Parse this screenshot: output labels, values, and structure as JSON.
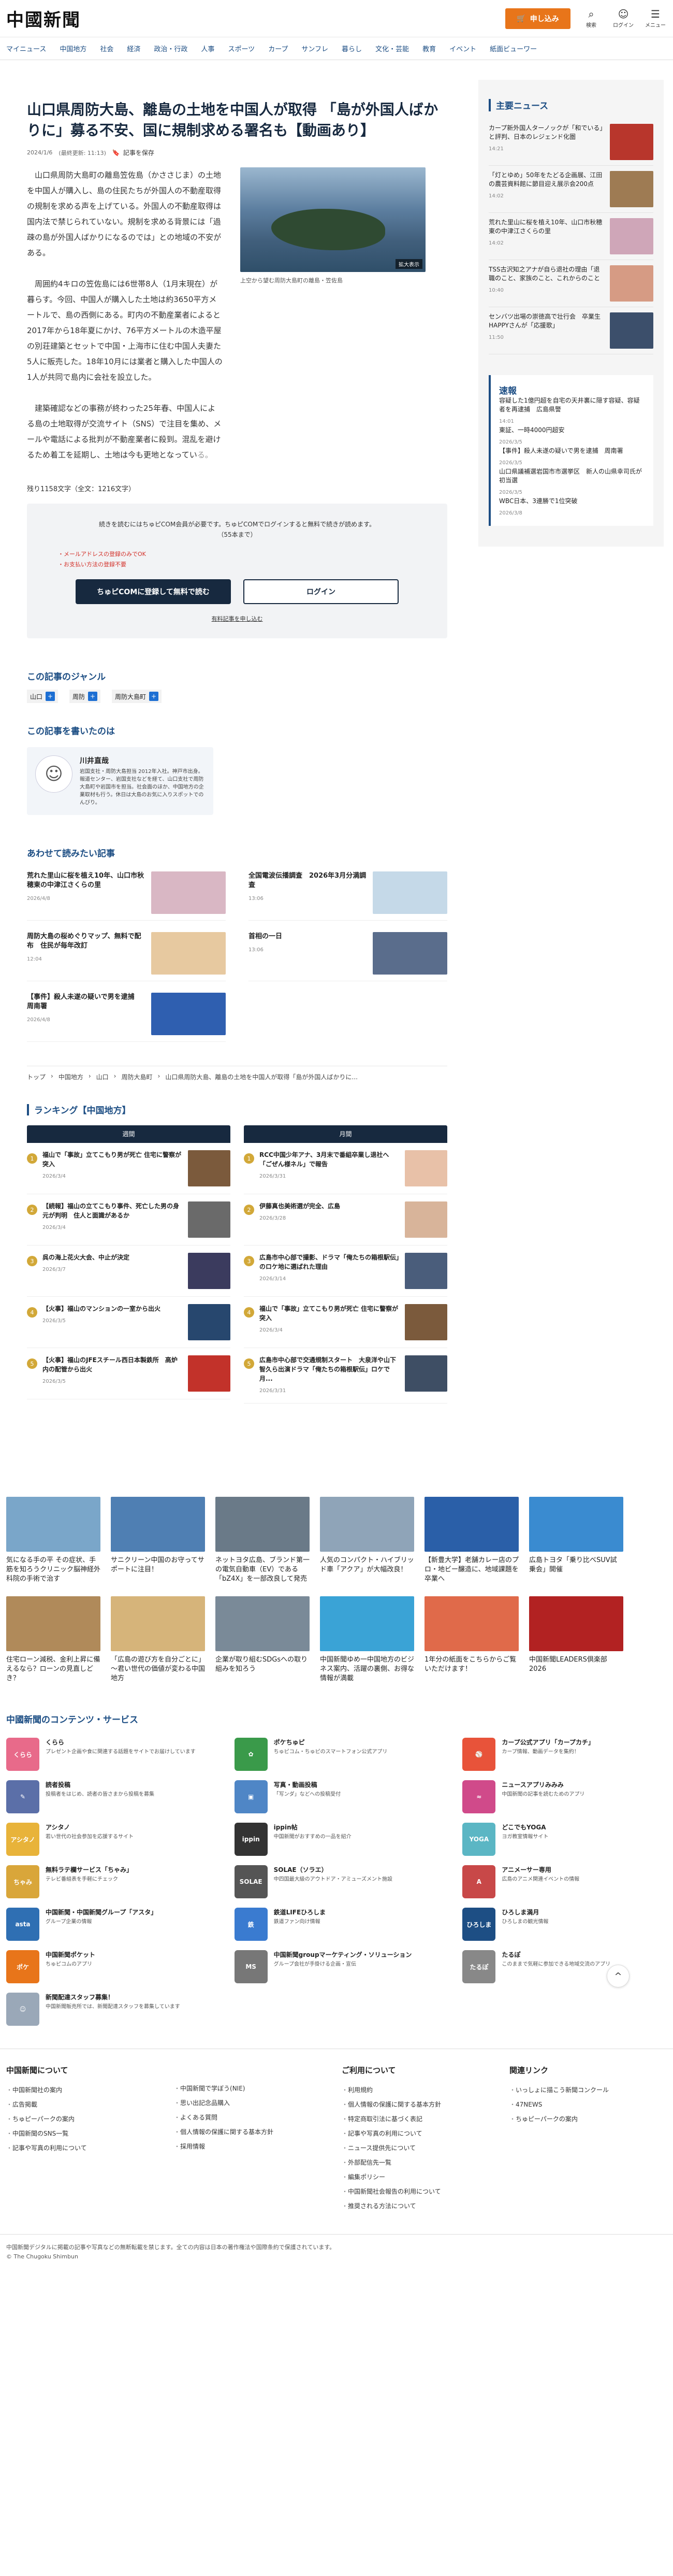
{
  "header": {
    "logo": "中國新聞",
    "subscribe_label": "申し込み",
    "search_label": "検索",
    "login_label": "ログイン",
    "menu_label": "メニュー"
  },
  "nav": [
    "マイニュース",
    "中国地方",
    "社会",
    "経済",
    "政治・行政",
    "人事",
    "スポーツ",
    "カープ",
    "サンフレ",
    "暮らし",
    "文化・芸能",
    "教育",
    "イベント",
    "紙面ビューワー"
  ],
  "article": {
    "title": "山口県周防大島、離島の土地を中国人が取得 「島が外国人ばかりに」募る不安、国に規制求める署名も【動画あり】",
    "date": "2024/1/6",
    "updated": "(最終更新: 11:13)",
    "bookmark_label": "記事を保存",
    "paragraphs": [
      "山口県周防大島町の離島笠佐島（かささじま）の土地を中国人が購入し、島の住民たちが外国人の不動産取得の規制を求める声を上げている。外国人の不動産取得は国内法で禁じられていない。規制を求める背景には「過疎の島が外国人ばかりになるのでは」との地域の不安がある。",
      "周囲約4キロの笠佐島には6世帯8人（1月末現在）が暮らす。今回、中国人が購入した土地は約3650平方メートルで、島の西側にある。町内の不動産業者によると2017年から18年夏にかけ、76平方メートルの木造平屋の別荘建築とセットで中国・上海市に住む中国人夫妻た5人に販売した。18年10月には業者と購入した中国人の1人が共同で島内に会社を設立した。",
      "建築確認などの事務が終わった25年春、中国人による島の土地取得が交流サイト（SNS）で注目を集め、メールや電話による批判が不動産業者に殺到。混乱を避けるため着工を延期し、土地は今も更地となってい"
    ],
    "fade_tail": "る。",
    "figure_caption": "上空から望む周防大島町の離島・笠佐島",
    "enlarge_label": "拡大表示",
    "char_count": "残り1158文字（全文：1216文字）"
  },
  "paywall": {
    "message_1": "続きを読むにはちゅピCOM会員が必要です。ちゅピCOMでログインすると無料で続きが読めます。",
    "message_2": "（55本まで）",
    "list": [
      "・メールアドレスの登録のみでOK",
      "・お支払い方法の登録不要"
    ],
    "register_label": "ちゅピCOMに登録して無料で読む",
    "login_label": "ログイン",
    "terms_label": "有料記事を申し込む"
  },
  "genre": {
    "heading": "この記事のジャンル",
    "tags": [
      "山口",
      "周防",
      "周防大島町"
    ]
  },
  "writer": {
    "heading": "この記事を書いたのは",
    "name": "川井直哉",
    "bio": "岩国支社・周防大島担当 2012年入社。神戸市出身。報道センター、岩国支社などを経て、山口支社で周防大島町や岩国市を担当。社会面のほか、中国地方の企業取材も行う。休日は大島のお気に入りスポットでのんびり。"
  },
  "related": {
    "heading": "あわせて読みたい記事",
    "items": [
      {
        "title": "荒れた里山に桜を植え10年、山口市秋穂東の中津江さくらの里",
        "date": "2026/4/8",
        "color": "#d9b7c4"
      },
      {
        "title": "全国電波伝播調査　2026年3月分満調査",
        "date": "13:06",
        "color": "#c5d9e8"
      },
      {
        "title": "周防大島の桜めぐりマップ、無料で配布　住民が毎年改訂",
        "date": "12:04",
        "color": "#e7c9a0"
      },
      {
        "title": "首相の一日",
        "date": "13:06",
        "color": "#5a6d8c"
      },
      {
        "title": "【事件】殺人未遂の疑いで男を逮捕　周南署",
        "date": "2026/4/8",
        "color": "#2f5fb0"
      }
    ]
  },
  "breadcrumb": [
    "トップ",
    "中国地方",
    "山口",
    "周防大島町",
    "山口県周防大島、離島の土地を中国人が取得「島が外国人ばかりに..."
  ],
  "ranking": {
    "heading": "ランキング【中国地方】",
    "weekly_label": "週間",
    "monthly_label": "月間",
    "weekly": [
      {
        "title": "福山で「事故」立てこもり男が死亡 住宅に警察が突入",
        "date": "2026/3/4",
        "color": "#7b5a3c"
      },
      {
        "title": "【続報】福山の立てこもり事件、死亡した男の身元が判明　住人と面識があるか",
        "date": "2026/3/4",
        "color": "#6a6a6a"
      },
      {
        "title": "呉の海上花火大会、中止が決定",
        "date": "2026/3/7",
        "color": "#3b3b5e"
      },
      {
        "title": "【火事】福山のマンションの一室から出火",
        "date": "2026/3/5",
        "color": "#27476e"
      },
      {
        "title": "【火事】福山のJFEスチール西日本製鉄所　高炉内の配管から出火",
        "date": "2026/3/5",
        "color": "#c2322a"
      }
    ],
    "monthly": [
      {
        "title": "RCC中国少年アナ、3月末で番組卒業し退社へ「ごぜん様ネル」で報告",
        "date": "2026/3/31",
        "color": "#e8c1a8"
      },
      {
        "title": "伊藤真也美術選が完全、広島",
        "date": "2026/3/28",
        "color": "#d8b49a"
      },
      {
        "title": "広島市中心部で撮影、ドラマ「俺たちの箱根駅伝」のロケ地に選ばれた理由",
        "date": "2026/3/14",
        "color": "#4a5d7b"
      },
      {
        "title": "福山で「事故」立てこもり男が死亡 住宅に警察が突入",
        "date": "2026/3/4",
        "color": "#7b5a3c"
      },
      {
        "title": "広島市中心部で交通規制スタート　大泉洋や山下智久ら出演ドラマ「俺たちの箱根駅伝」ロケで月...",
        "date": "2026/3/31",
        "color": "#3e4e64"
      }
    ]
  },
  "side": {
    "main_news_heading": "主要ニュース",
    "main_news": [
      {
        "title": "カープ新外国人ターノックが「和でいる」と評判、日本のレジェンド化圏",
        "date": "14:21",
        "color": "#b8362c"
      },
      {
        "title": "「灯とゆめ」50年をたどる企画展、江田の農芸資料館に節目迎え展示会200点",
        "date": "14:02",
        "color": "#9e7b53"
      },
      {
        "title": "荒れた里山に桜を植え10年、山口市秋穂東の中津江さくらの里",
        "date": "14:02",
        "color": "#cfa6b8"
      },
      {
        "title": "TSS古沢知之アナが自ら退社の理由「退職のこと、家族のこと、これからのこと",
        "date": "10:40",
        "color": "#d69b84"
      },
      {
        "title": "センバツ出場の崇徳高で壮行会　卒業生HAPPYさんが「応援歌」",
        "date": "11:50",
        "color": "#3c4f6b"
      }
    ],
    "sokuho_heading": "速報",
    "sokuho": [
      {
        "title": "容疑した1億円超を自宅の天井裏に隠す容疑、容疑者を再逮捕　広島県警",
        "date": "14:01"
      },
      {
        "title": "東証、一時4000円超安",
        "date": "2026/3/5"
      },
      {
        "title": "【事件】殺人未遂の疑いで男を逮捕　周南署",
        "date": "2026/3/5"
      },
      {
        "title": "山口県議補選岩国市市選挙区　新人の山県幸司氏が初当選",
        "date": "2026/3/5"
      },
      {
        "title": "WBC日本、3連勝で1位突破",
        "date": "2026/3/8"
      }
    ]
  },
  "features": [
    {
      "title": "気になる手の平 その症状、手筋を知ろうクリニック脳神経外科院の手術で治す",
      "color": "#7aa6c9"
    },
    {
      "title": "サニクリーン中国のお守ってサポートに注目！",
      "color": "#4f7fb3"
    },
    {
      "title": "ネットヨタ広島、ブランド第一の電気自動車（EV）である「bZ4X」を一部改良して発売",
      "color": "#6a7a88"
    },
    {
      "title": "人気のコンパクト・ハイブリッド車「アクア」が大幅改良！",
      "color": "#8fa4b8"
    },
    {
      "title": "【新豊大学】老舗カレー店のプロ・地ビー醸造に、地域課題を卒業へ",
      "color": "#2a5fa8"
    },
    {
      "title": "広島トヨタ「乗り比べSUV試乗会」開催",
      "color": "#3a8bd0"
    },
    {
      "title": "住宅ローン減税、金利上昇に備えるなら？ローンの見直しどき？",
      "color": "#b08a5a"
    },
    {
      "title": "「広島の遊び方を自分ごとに」～君い世代の価値が変わる中国地方",
      "color": "#d6b47a"
    },
    {
      "title": "企業が取り組むSDGsへの取り組みを知ろう",
      "color": "#7a8a98"
    },
    {
      "title": "中国新聞ゆめ一中国地方のビジネス案内、活躍の裏側、お得な情報が満載",
      "color": "#3aa3d6"
    },
    {
      "title": "1年分の紙面をこちらからご覧いただけます！",
      "color": "#e06a4a"
    },
    {
      "title": "中国新聞LEADERS倶楽部2026",
      "color": "#b22222"
    }
  ],
  "services_heading": "中國新聞のコンテンツ・サービス",
  "services": [
    {
      "title": "くらら",
      "desc": "プレゼント企画や食に関連する話題をサイトでお届けしています",
      "color": "#e86a8a",
      "icon": "くらら"
    },
    {
      "title": "ポケちゅピ",
      "desc": "ちゅピコム・ちゅピのスマートフォン公式アプリ",
      "color": "#3a9a4a",
      "icon": "✿"
    },
    {
      "title": "カープ公式アプリ「カープカチ」",
      "desc": "カープ情報、動画データを集約！",
      "color": "#e8533a",
      "icon": "⚾"
    },
    {
      "title": "読者投稿",
      "desc": "投稿者をはじめ、読者の皆さまから投稿を募集",
      "color": "#5b6fa8",
      "icon": "✎"
    },
    {
      "title": "写真・動画投稿",
      "desc": "「写ンダ」などへの投稿受付",
      "color": "#4f86c6",
      "icon": "▣"
    },
    {
      "title": "ニュースアプリみみみ",
      "desc": "中国新聞の記事を読むためのアプリ",
      "color": "#d04a8a",
      "icon": "≈"
    },
    {
      "title": "アシタノ",
      "desc": "若い世代の社会参加を応援するサイト",
      "color": "#e8b33a",
      "icon": "アシタノ"
    },
    {
      "title": "ippin帖",
      "desc": "中国新聞がおすすめの一品を紹介",
      "color": "#333333",
      "icon": "ippin"
    },
    {
      "title": "どこでもYOGA",
      "desc": "ヨガ教室情報サイト",
      "color": "#5bb6c4",
      "icon": "YOGA"
    },
    {
      "title": "無料ラテ欄サービス「ちゃみ」",
      "desc": "テレビ番組表を手軽にチェック",
      "color": "#d9a63a",
      "icon": "ちゃみ"
    },
    {
      "title": "SOLAE（ソラエ）",
      "desc": "中四国最大級のアウトドア・アミューズメント施設",
      "color": "#555555",
      "icon": "SOLAE"
    },
    {
      "title": "アニメーサー専用",
      "desc": "広島のアニメ関連イベントの情報",
      "color": "#c84848",
      "icon": "A"
    },
    {
      "title": "中国新聞・中国新聞グループ「アスタ」",
      "desc": "グループ企業の情報",
      "color": "#2f6fb3",
      "icon": "asta"
    },
    {
      "title": "鉄道LIFEひろしま",
      "desc": "鉄道ファン向け情報",
      "color": "#3a7bd0",
      "icon": "鉄"
    },
    {
      "title": "ひろしま満月",
      "desc": "ひろしまの観光情報",
      "color": "#1d4e84",
      "icon": "ひろしま"
    },
    {
      "title": "中国新聞ポケット",
      "desc": "ちゅピコムのアプリ",
      "color": "#e8751a",
      "icon": "ポケ"
    },
    {
      "title": "中国新聞groupマーケティング・ソリューション",
      "desc": "グループ会社が手掛ける企画・宣伝",
      "color": "#777777",
      "icon": "MS"
    },
    {
      "title": "たるぽ",
      "desc": "このままで気軽に参加できる地域交流のアプリ",
      "color": "#888888",
      "icon": "たるぽ"
    },
    {
      "title": "新聞配達スタッフ募集！",
      "desc": "中国新聞販売所では、新聞配達スタッフを募集しています",
      "color": "#9aa8b8",
      "icon": "☺"
    }
  ],
  "footer": {
    "col1_heading": "中国新聞について",
    "col1": [
      "中国新聞社の案内",
      "広告掲載",
      "ちゅピーパークの案内",
      "中国新聞のSNS一覧",
      "記事や写真の利用について"
    ],
    "col2": [
      "中国新聞で学ぼう(NIE)",
      "思い出記念品購入",
      "よくある質問",
      "個人情報の保護に関する基本方針",
      "採用情報"
    ],
    "col3_heading": "ご利用について",
    "col3": [
      "利用規約",
      "個人情報の保護に関する基本方針",
      "特定商取引法に基づく表記",
      "記事や写真の利用について",
      "ニュース提供先について",
      "外部配信先一覧",
      "編集ポリシー",
      "中国新聞社会報告の利用について",
      "推奨される方法について"
    ],
    "col4_heading": "関連リンク",
    "col4": [
      "いっしょに描こう新聞コンクール",
      "47NEWS",
      "ちゅピーパークの案内"
    ]
  },
  "copyright": {
    "line1": "中国新聞デジタルに掲載の記事や写真などの無断転載を禁じます。全ての内容は日本の著作権法や国際条約で保護されています。",
    "line2": "© The Chugoku Shimbun"
  },
  "scroll_top_label": "^"
}
